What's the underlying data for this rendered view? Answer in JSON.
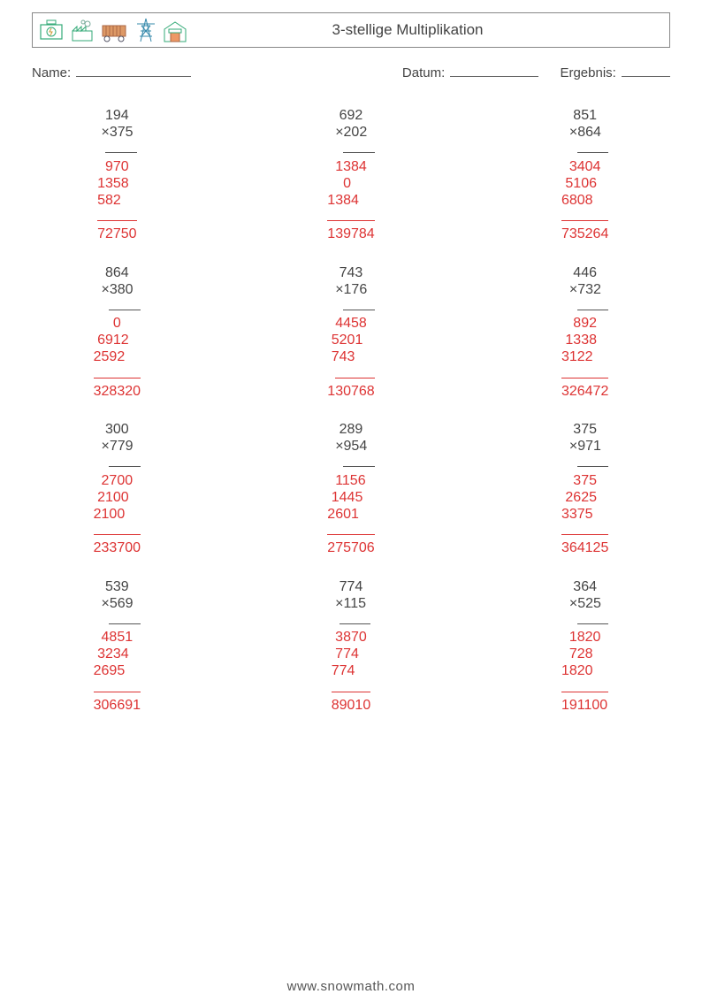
{
  "header": {
    "title": "3-stellige Multiplikation"
  },
  "meta": {
    "name_label": "Name:",
    "date_label": "Datum:",
    "result_label": "Ergebnis:"
  },
  "problems": [
    {
      "a": 194,
      "b": 375,
      "partials": [
        970,
        1358,
        582
      ],
      "result": 72750
    },
    {
      "a": 692,
      "b": 202,
      "partials": [
        1384,
        0,
        1384
      ],
      "result": 139784
    },
    {
      "a": 851,
      "b": 864,
      "partials": [
        3404,
        5106,
        6808
      ],
      "result": 735264
    },
    {
      "a": 864,
      "b": 380,
      "partials": [
        0,
        6912,
        2592
      ],
      "result": 328320
    },
    {
      "a": 743,
      "b": 176,
      "partials": [
        4458,
        5201,
        743
      ],
      "result": 130768
    },
    {
      "a": 446,
      "b": 732,
      "partials": [
        892,
        1338,
        3122
      ],
      "result": 326472
    },
    {
      "a": 300,
      "b": 779,
      "partials": [
        2700,
        2100,
        2100
      ],
      "result": 233700
    },
    {
      "a": 289,
      "b": 954,
      "partials": [
        1156,
        1445,
        2601
      ],
      "result": 275706
    },
    {
      "a": 375,
      "b": 971,
      "partials": [
        375,
        2625,
        3375
      ],
      "result": 364125
    },
    {
      "a": 539,
      "b": 569,
      "partials": [
        4851,
        3234,
        2695
      ],
      "result": 306691
    },
    {
      "a": 774,
      "b": 115,
      "partials": [
        3870,
        774,
        774
      ],
      "result": 89010
    },
    {
      "a": 364,
      "b": 525,
      "partials": [
        1820,
        728,
        1820
      ],
      "result": 191100
    }
  ],
  "footer": {
    "url": "www.snowmath.com"
  }
}
